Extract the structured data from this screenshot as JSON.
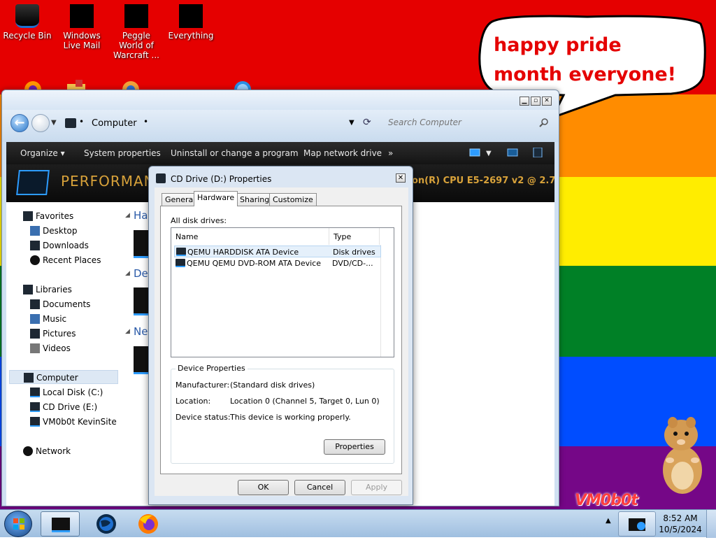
{
  "desktop": {
    "icons": [
      {
        "label": "Recycle Bin"
      },
      {
        "label": "Windows Live Mail"
      },
      {
        "label": "Peggle World of Warcraft ..."
      },
      {
        "label": "Everything"
      }
    ],
    "bubble_text": "happy pride month everyone!",
    "logo_text": "VM0b0t",
    "colors": {
      "red": "#e50000",
      "orange": "#ff8c00",
      "yellow": "#ffed00",
      "green": "#008026",
      "blue": "#004dff",
      "purple": "#750787"
    }
  },
  "explorer": {
    "address": {
      "location": "Computer"
    },
    "search": {
      "placeholder": "Search Computer"
    },
    "toolbar": {
      "organize": "Organize",
      "system_properties": "System properties",
      "uninstall": "Uninstall or change a program",
      "map_drive": "Map network drive",
      "more": "»"
    },
    "banner": {
      "title": "PERFORMAN",
      "cpu": "on(R) CPU E5-2697 v2 @ 2.7..."
    },
    "nav": {
      "favorites": "Favorites",
      "desktop": "Desktop",
      "downloads": "Downloads",
      "recent": "Recent Places",
      "libraries": "Libraries",
      "documents": "Documents",
      "music": "Music",
      "pictures": "Pictures",
      "videos": "Videos",
      "computer": "Computer",
      "local_disk": "Local Disk (C:)",
      "cd_drive": "CD Drive (E:)",
      "vm_site": "VM0b0t KevinSite",
      "network": "Network"
    },
    "content": {
      "group1": "Har",
      "group2": "Dev",
      "group3": "Net"
    }
  },
  "dialog": {
    "title": "CD Drive (D:) Properties",
    "tabs": [
      {
        "label": "General"
      },
      {
        "label": "Hardware"
      },
      {
        "label": "Sharing"
      },
      {
        "label": "Customize"
      }
    ],
    "active_tab": "Hardware",
    "all_disk_drives": "All disk drives:",
    "columns": {
      "name": "Name",
      "type": "Type"
    },
    "drives": [
      {
        "name": "QEMU HARDDISK ATA Device",
        "type": "Disk drives"
      },
      {
        "name": "QEMU QEMU DVD-ROM ATA Device",
        "type": "DVD/CD-..."
      }
    ],
    "device_properties": {
      "legend": "Device Properties",
      "manufacturer_label": "Manufacturer:",
      "manufacturer": "(Standard disk drives)",
      "location_label": "Location:",
      "location": "Location 0 (Channel 5, Target 0, Lun 0)",
      "status_label": "Device status:",
      "status": "This device is working properly."
    },
    "buttons": {
      "properties": "Properties",
      "ok": "OK",
      "cancel": "Cancel",
      "apply": "Apply"
    }
  },
  "taskbar": {
    "time": "8:52 AM",
    "date": "10/5/2024"
  }
}
